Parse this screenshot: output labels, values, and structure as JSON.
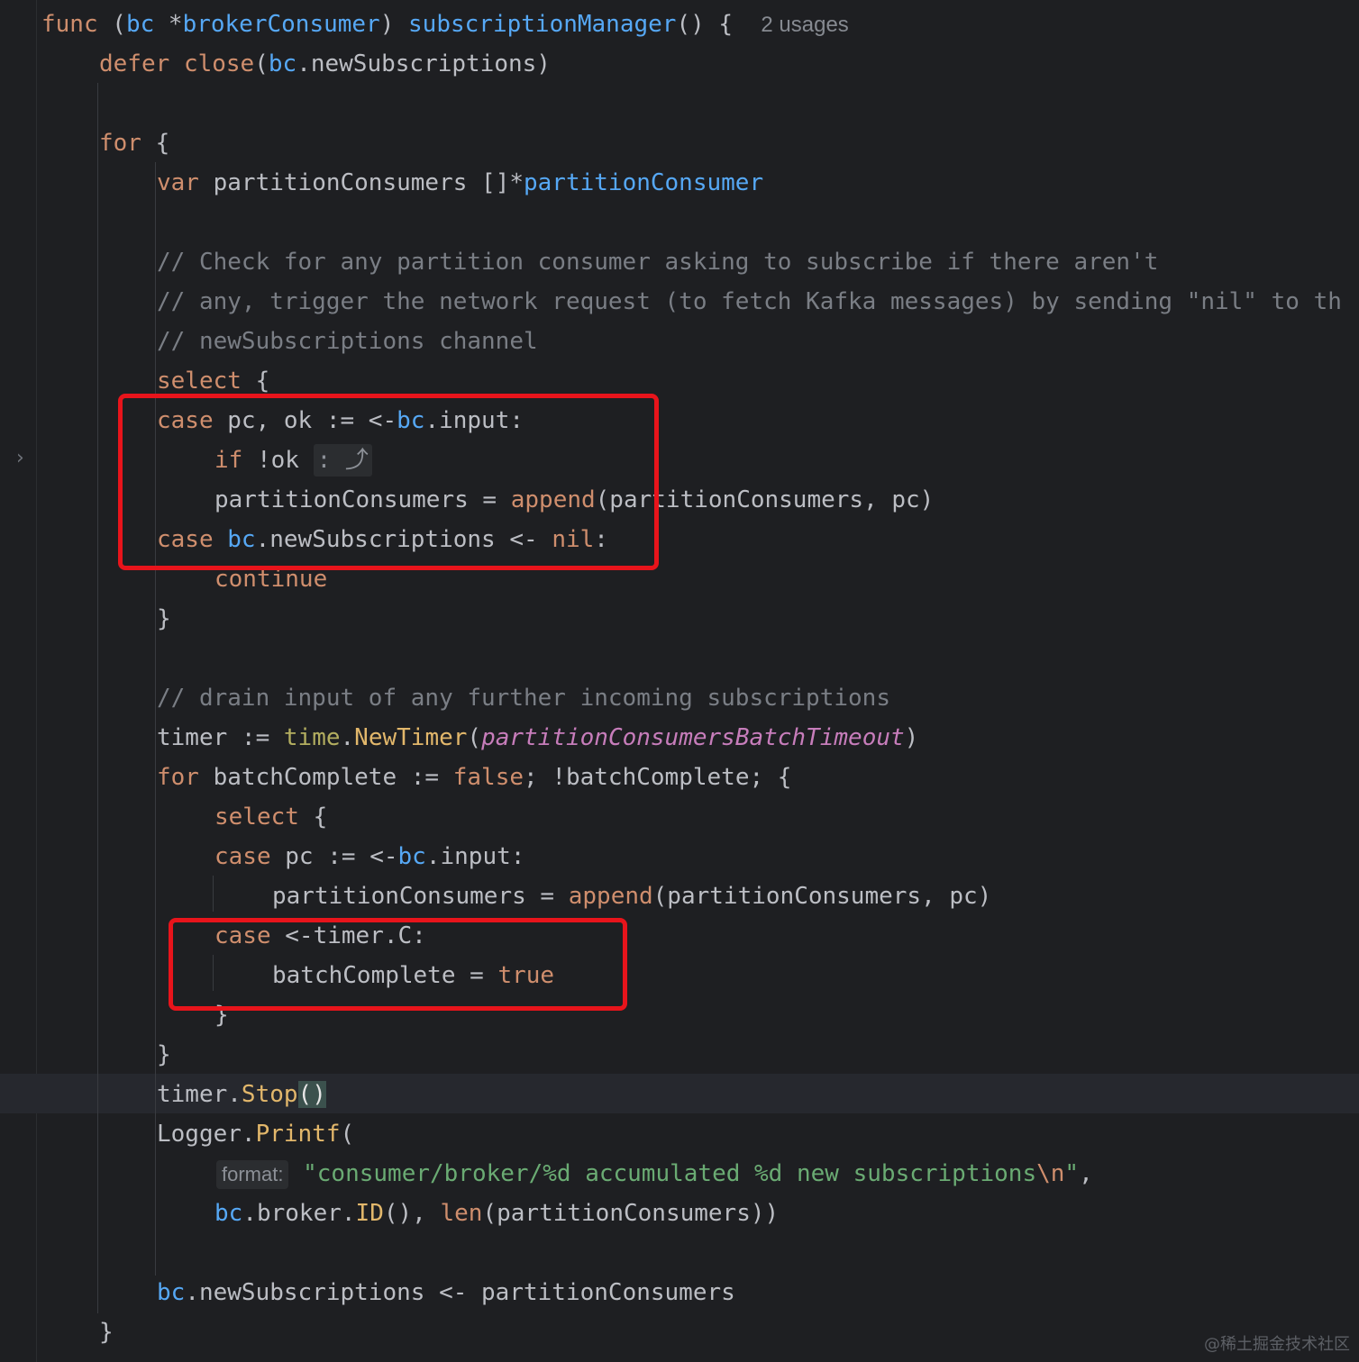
{
  "editor": {
    "gutter": {
      "fold_marker": "›"
    },
    "header": {
      "func_kw": "func",
      "open_paren": "(",
      "receiver": "bc",
      "star": "*",
      "receiver_type": "brokerConsumer",
      "close_paren": ")",
      "func_name": "subscriptionManager",
      "signature_end": "() {",
      "usages_hint": "2 usages"
    },
    "lines": {
      "defer_kw": "defer",
      "close_call": "close",
      "defer_arg_open": "(",
      "defer_recv": "bc",
      "defer_arg": ".newSubscriptions)",
      "for_kw": "for",
      "for_brace": " {",
      "var_kw": "var",
      "var_decl": " partitionConsumers []*",
      "var_type": "partitionConsumer",
      "comment1": "// Check for any partition consumer asking to subscribe if there aren't",
      "comment2": "// any, trigger the network request (to fetch Kafka messages) by sending \"nil\" to th",
      "comment3": "// newSubscriptions channel",
      "select1_kw": "select",
      "select1_brace": " {",
      "case1_kw": "case",
      "case1_text": " pc, ok := <-",
      "case1_recv": "bc",
      "case1_end": ".input:",
      "if_kw": "if",
      "if_text": " !ok ",
      "if_fold": ": ⤴",
      "append1_lhs": "partitionConsumers = ",
      "append1_fn": "append",
      "append1_args": "(partitionConsumers, pc)",
      "case2_kw": "case",
      "case2_space": " ",
      "case2_recv": "bc",
      "case2_text": ".newSubscriptions <- ",
      "case2_nil": "nil",
      "case2_colon": ":",
      "continue_kw": "continue",
      "select1_close": "}",
      "comment4": "// drain input of any further incoming subscriptions",
      "timer_lhs": "timer := ",
      "timer_pkg": "time",
      "timer_dot": ".",
      "timer_fn": "NewTimer",
      "timer_open": "(",
      "timer_const": "partitionConsumersBatchTimeout",
      "timer_close": ")",
      "for2_kw": "for",
      "for2_text1": " batchComplete := ",
      "for2_false": "false",
      "for2_text2": "; !batchComplete; {",
      "select2_kw": "select",
      "select2_brace": " {",
      "case3_kw": "case",
      "case3_text": " pc := <-",
      "case3_recv": "bc",
      "case3_end": ".input:",
      "append2_lhs": "partitionConsumers = ",
      "append2_fn": "append",
      "append2_args": "(partitionConsumers, pc)",
      "case4_kw": "case",
      "case4_text": " <-timer.C:",
      "batch_lhs": "batchComplete = ",
      "batch_true": "true",
      "select2_close": "}",
      "for2_close": "}",
      "stop_obj": "timer.",
      "stop_fn": "Stop",
      "stop_parens": "()",
      "logger_obj": "Logger.",
      "logger_fn": "Printf",
      "logger_open": "(",
      "format_hint": "format:",
      "format_str": "\"consumer/broker/%d accumulated %d new subscriptions",
      "format_esc": "\\n",
      "format_end_quote": "\"",
      "format_comma": ",",
      "arg_recv": "bc",
      "arg_broker": ".broker.",
      "arg_id_fn": "ID",
      "arg_id_rest": "(), ",
      "arg_len_fn": "len",
      "arg_len_rest": "(partitionConsumers))",
      "send_recv": "bc",
      "send_text": ".newSubscriptions <- partitionConsumers",
      "for_close": "}"
    }
  },
  "watermark": "@稀土掘金技术社区",
  "colors": {
    "background": "#1e1f22",
    "keyword": "#cf8e6d",
    "function": "#56a8f5",
    "comment": "#7a7e85",
    "string": "#6aab73",
    "constant": "#c77dbb",
    "highlight_box": "#e8141b"
  }
}
